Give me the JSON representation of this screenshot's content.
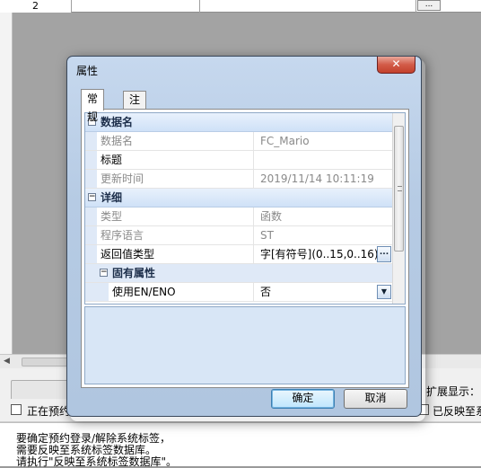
{
  "background": {
    "row_number": "2",
    "ellipsis": "...",
    "expand_display_label": "扩展显示：",
    "checkbox_left_label": "正在预约",
    "checkbox_right_label": "已反映至系",
    "messages": [
      "要确定预约登录/解除系统标签，",
      "需要反映至系统标签数据库。",
      "请执行\"反映至系统标签数据库\"。"
    ]
  },
  "dialog": {
    "title": "属性",
    "close_glyph": "✕",
    "tabs": [
      {
        "label": "常规",
        "active": true
      },
      {
        "label": "注释",
        "active": false
      }
    ],
    "grid": {
      "category_data_name": "数据名",
      "category_details": "详细",
      "subcategory_inherent": "固有属性",
      "rows": {
        "data_name": {
          "name": "数据名",
          "value": "FC_Mario"
        },
        "caption": {
          "name": "标题",
          "value": ""
        },
        "updated": {
          "name": "更新时间",
          "value": "2019/11/14 10:11:19"
        },
        "type": {
          "name": "类型",
          "value": "函数"
        },
        "language": {
          "name": "程序语言",
          "value": "ST"
        },
        "return_type": {
          "name": "返回值类型",
          "value": "字[有符号](0..15,0..16)"
        },
        "use_en_eno": {
          "name": "使用EN/ENO",
          "value": "否"
        }
      },
      "collapse_glyph": "−",
      "ellipsis_glyph": "...",
      "dropdown_glyph": "▼"
    },
    "ok_label": "确定",
    "cancel_label": "取消"
  }
}
